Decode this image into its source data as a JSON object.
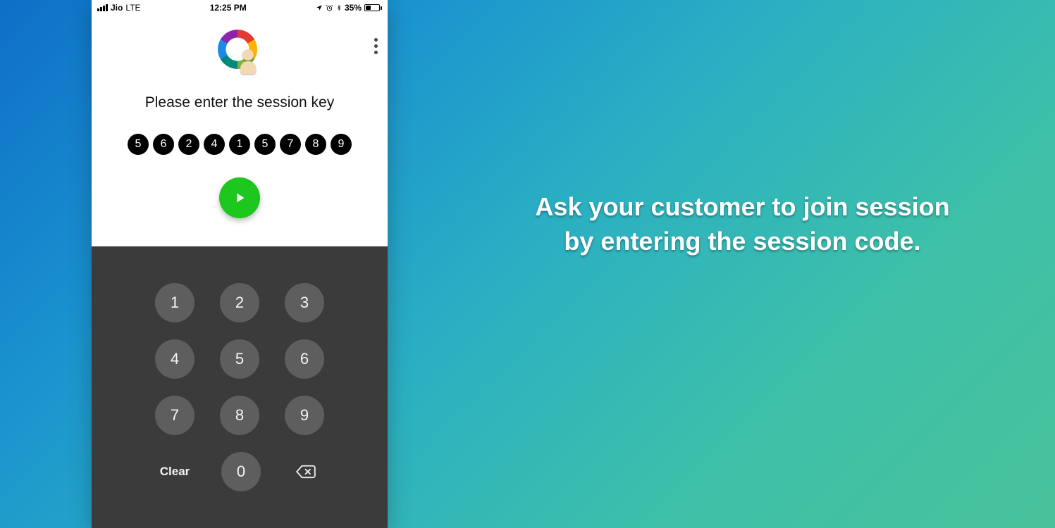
{
  "statusbar": {
    "carrier": "Jio",
    "network": "LTE",
    "time": "12:25 PM",
    "battery_pct": "35%"
  },
  "screen": {
    "prompt": "Please enter the session key",
    "digits": [
      "5",
      "6",
      "2",
      "4",
      "1",
      "5",
      "7",
      "8",
      "9"
    ]
  },
  "keypad": {
    "keys": [
      "1",
      "2",
      "3",
      "4",
      "5",
      "6",
      "7",
      "8",
      "9",
      "0"
    ],
    "clear_label": "Clear"
  },
  "promo": {
    "line1": "Ask your customer to join session",
    "line2": "by entering the session code."
  }
}
